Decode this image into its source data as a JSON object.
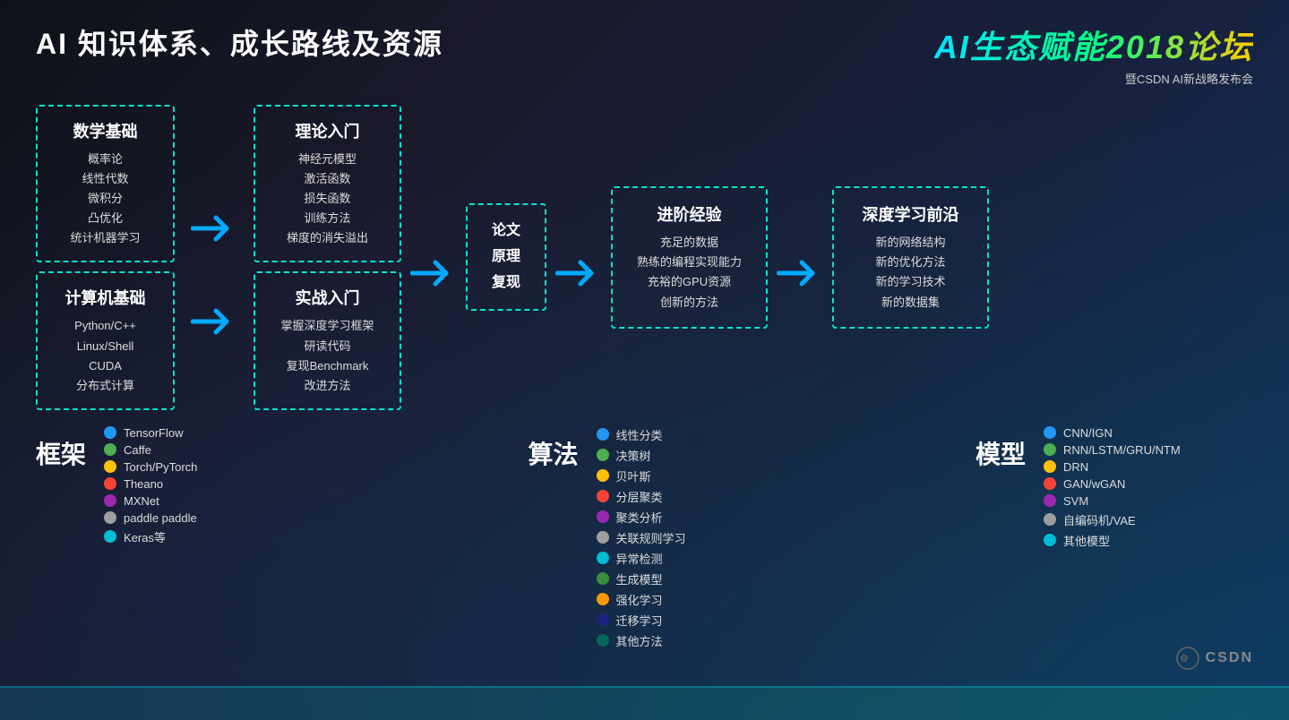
{
  "header": {
    "main_title": "AI 知识体系、成长路线及资源",
    "logo_main": "AI生态赋能2018论坛",
    "logo_sub": "暨CSDN AI新战略发布会"
  },
  "boxes": {
    "math": {
      "title": "数学基础",
      "items": [
        "概率论",
        "线性代数",
        "微积分",
        "凸优化",
        "统计机器学习"
      ]
    },
    "computer": {
      "title": "计算机基础",
      "items": [
        "Python/C++",
        "Linux/Shell",
        "CUDA",
        "分布式计算"
      ]
    },
    "theory": {
      "title": "理论入门",
      "items": [
        "神经元模型",
        "激活函数",
        "损失函数",
        "训练方法",
        "梯度的消失溢出"
      ]
    },
    "practice": {
      "title": "实战入门",
      "items": [
        "掌握深度学习框架",
        "研读代码",
        "复现Benchmark",
        "改进方法"
      ]
    },
    "paper": {
      "title": "论文\n原理\n复现"
    },
    "advanced": {
      "title": "进阶经验",
      "items": [
        "充足的数据",
        "熟练的编程实现能力",
        "充裕的GPU资源",
        "创新的方法"
      ]
    },
    "deep": {
      "title": "深度学习前沿",
      "items": [
        "新的网络结构",
        "新的优化方法",
        "新的学习技术",
        "新的数据集"
      ]
    }
  },
  "legend": {
    "framework": {
      "title": "框架",
      "items": [
        {
          "label": "TensorFlow",
          "color": "#2196F3"
        },
        {
          "label": "Caffe",
          "color": "#4CAF50"
        },
        {
          "label": "Torch/PyTorch",
          "color": "#FFC107"
        },
        {
          "label": "Theano",
          "color": "#F44336"
        },
        {
          "label": "MXNet",
          "color": "#9C27B0"
        },
        {
          "label": "paddle paddle",
          "color": "#9E9E9E"
        },
        {
          "label": "Keras等",
          "color": "#00BCD4"
        }
      ]
    },
    "algorithm": {
      "title": "算法",
      "items": [
        {
          "label": "线性分类",
          "color": "#2196F3"
        },
        {
          "label": "决策树",
          "color": "#4CAF50"
        },
        {
          "label": "贝叶斯",
          "color": "#FFC107"
        },
        {
          "label": "分层聚类",
          "color": "#F44336"
        },
        {
          "label": "聚类分析",
          "color": "#9C27B0"
        },
        {
          "label": "关联规则学习",
          "color": "#9E9E9E"
        },
        {
          "label": "异常检测",
          "color": "#00BCD4"
        },
        {
          "label": "生成模型",
          "color": "#388E3C"
        },
        {
          "label": "强化学习",
          "color": "#FF9800"
        },
        {
          "label": "迁移学习",
          "color": "#1A237E"
        },
        {
          "label": "其他方法",
          "color": "#00695C"
        }
      ]
    },
    "model": {
      "title": "模型",
      "items": [
        {
          "label": "CNN/IGN",
          "color": "#2196F3"
        },
        {
          "label": "RNN/LSTM/GRU/NTM",
          "color": "#4CAF50"
        },
        {
          "label": "DRN",
          "color": "#FFC107"
        },
        {
          "label": "GAN/wGAN",
          "color": "#F44336"
        },
        {
          "label": "SVM",
          "color": "#9C27B0"
        },
        {
          "label": "自编码机/VAE",
          "color": "#9E9E9E"
        },
        {
          "label": "其他模型",
          "color": "#00BCD4"
        }
      ]
    }
  },
  "arrows": {
    "symbol": "→"
  }
}
